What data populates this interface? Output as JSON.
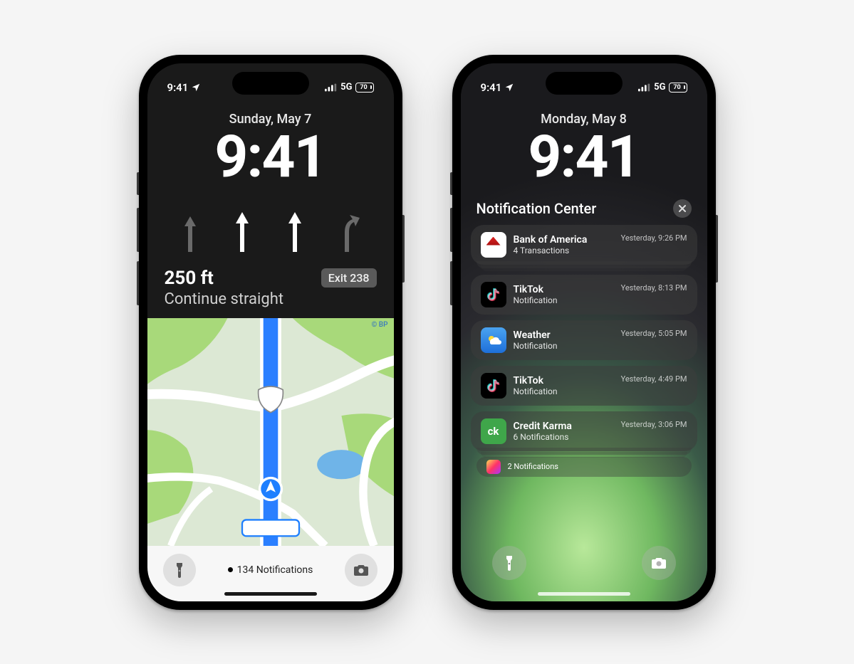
{
  "status": {
    "time": "9:41",
    "network_label": "5G",
    "battery_pct": "70"
  },
  "phone1": {
    "date": "Sunday, May 7",
    "time": "9:41",
    "nav": {
      "distance": "250 ft",
      "exit_label": "Exit 238",
      "instruction": "Continue straight"
    },
    "map_attribution": "© BP",
    "notifications_label": "134 Notifications"
  },
  "phone2": {
    "date": "Monday, May 8",
    "time": "9:41",
    "nc_title": "Notification Center",
    "notifications": [
      {
        "app": "Bank of America",
        "subtitle": "4 Transactions",
        "time": "Yesterday, 9:26 PM",
        "icon_bg": "#fff",
        "icon_text": "",
        "stacked": true,
        "icon_kind": "bofa"
      },
      {
        "app": "TikTok",
        "subtitle": "Notification",
        "time": "Yesterday, 8:13 PM",
        "icon_bg": "#000",
        "icon_text": "",
        "stacked": false,
        "icon_kind": "tiktok"
      },
      {
        "app": "Weather",
        "subtitle": "Notification",
        "time": "Yesterday, 5:05 PM",
        "icon_bg": "linear-gradient(#4aa3f0,#1e6fd9)",
        "icon_text": "",
        "stacked": false,
        "icon_kind": "weather"
      },
      {
        "app": "TikTok",
        "subtitle": "Notification",
        "time": "Yesterday, 4:49 PM",
        "icon_bg": "#000",
        "icon_text": "",
        "stacked": false,
        "icon_kind": "tiktok"
      },
      {
        "app": "Credit Karma",
        "subtitle": "6 Notifications",
        "time": "Yesterday, 3:06 PM",
        "icon_bg": "#3fa64a",
        "icon_text": "ck",
        "stacked": true,
        "icon_kind": "ck"
      }
    ],
    "partial_label": "2 Notifications"
  }
}
